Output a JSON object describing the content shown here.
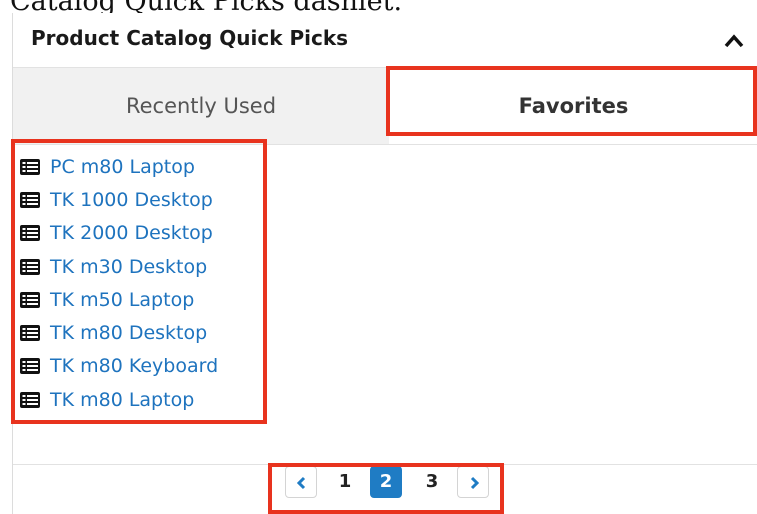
{
  "caption_partial": "Catalog Quick Picks dashlet.",
  "dashlet": {
    "title": "Product Catalog Quick Picks"
  },
  "tabs": {
    "recent": "Recently Used",
    "favorites": "Favorites",
    "active": "Favorites"
  },
  "products": [
    "PC m80 Laptop",
    "TK 1000 Desktop",
    "TK 2000 Desktop",
    "TK m30 Desktop",
    "TK m50 Laptop",
    "TK m80 Desktop",
    "TK m80 Keyboard",
    "TK m80 Laptop"
  ],
  "pagination": {
    "pages": [
      "1",
      "2",
      "3"
    ],
    "current": "2"
  },
  "colors": {
    "link": "#1e73be",
    "active_page": "#1f7cc4",
    "highlight": "#e8331e",
    "tab_bg": "#f1f1f1"
  },
  "icons": {
    "product": "product-list-icon",
    "collapse": "chevron-up-icon",
    "prev": "chevron-left-icon",
    "next": "chevron-right-icon"
  }
}
